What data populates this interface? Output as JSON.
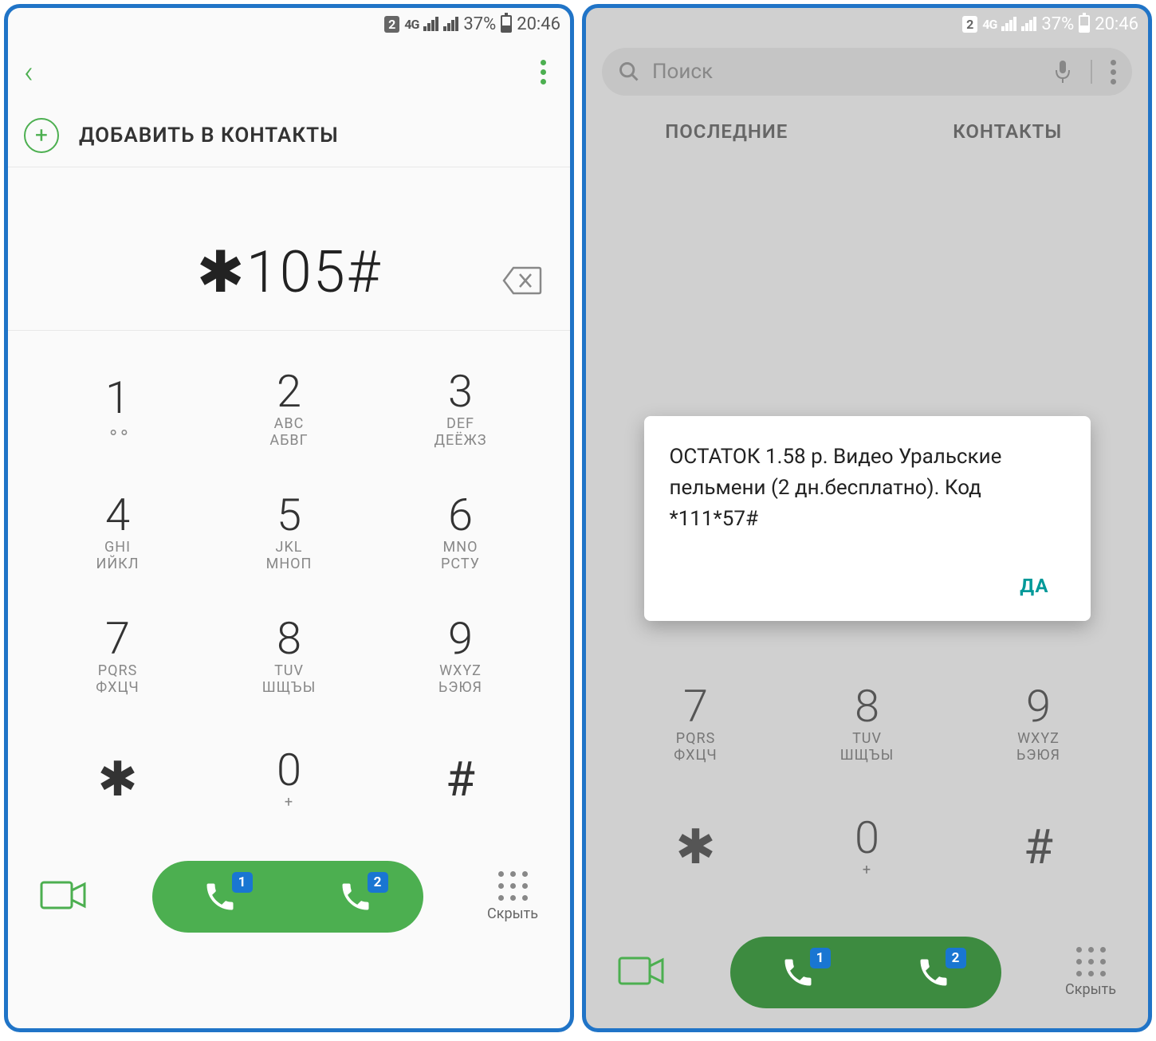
{
  "status": {
    "sim": "2",
    "network": "4G",
    "battery_pct": "37%",
    "time": "20:46"
  },
  "left": {
    "add_contact": "ДОБАВИТЬ В КОНТАКТЫ",
    "dialed": "✱105#"
  },
  "right": {
    "search_placeholder": "Поиск",
    "tab_recent": "ПОСЛЕДНИЕ",
    "tab_contacts": "КОНТАКТЫ",
    "modal_text": "ОСТАТОК 1.58 р. Видео Уральские пельмени (2 дн.бесплатно). Код *111*57#",
    "modal_ok": "ДА"
  },
  "keypad": [
    {
      "d": "1",
      "s1": "",
      "s2": "",
      "vm": true
    },
    {
      "d": "2",
      "s1": "ABC",
      "s2": "АБВГ"
    },
    {
      "d": "3",
      "s1": "DEF",
      "s2": "ДЕЁЖЗ"
    },
    {
      "d": "4",
      "s1": "GHI",
      "s2": "ИЙКЛ"
    },
    {
      "d": "5",
      "s1": "JKL",
      "s2": "МНОП"
    },
    {
      "d": "6",
      "s1": "MNO",
      "s2": "РСТУ"
    },
    {
      "d": "7",
      "s1": "PQRS",
      "s2": "ФХЦЧ"
    },
    {
      "d": "8",
      "s1": "TUV",
      "s2": "ШЩЪЫ"
    },
    {
      "d": "9",
      "s1": "WXYZ",
      "s2": "ЬЭЮЯ"
    },
    {
      "d": "✱",
      "s1": "",
      "s2": ""
    },
    {
      "d": "0",
      "s1": "+",
      "s2": ""
    },
    {
      "d": "#",
      "s1": "",
      "s2": ""
    }
  ],
  "bottom": {
    "sim1": "1",
    "sim2": "2",
    "hide": "Скрыть"
  }
}
